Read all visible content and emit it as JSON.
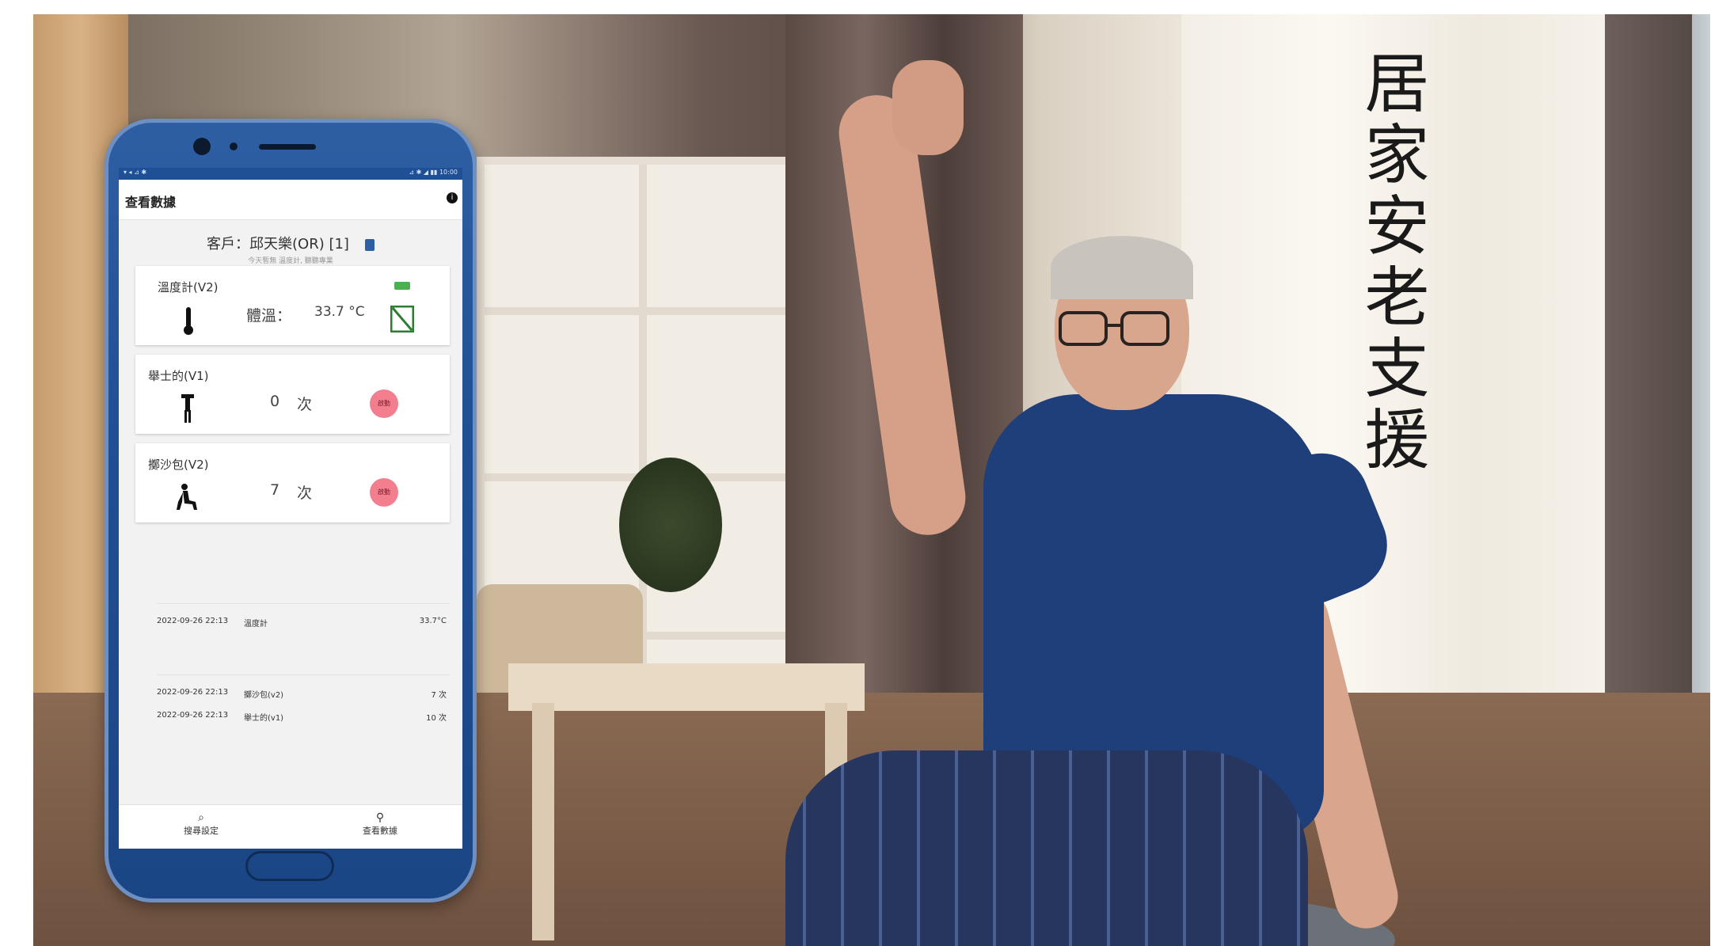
{
  "overlay_title": "居家安老支援",
  "phone": {
    "statusbar_left": "▾ ◂ ⊿ ✱",
    "statusbar_right": "⊿ ✱ ◢ ▮▮ 10:00",
    "app_title": "查看數據",
    "info_icon": "info-icon",
    "client_label": "客戶：邱天樂(OR) [1]",
    "client_sub": "今天暫無 溫度計, 聽聽專業",
    "cards": [
      {
        "name": "溫度計(V2)",
        "label": "體溫：",
        "value": "33.7 °C",
        "icon": "thermometer-icon"
      },
      {
        "name": "舉士的(V1)",
        "value": "0",
        "unit": "次",
        "icon": "standing-person-icon",
        "badge": "啟動"
      },
      {
        "name": "擲沙包(V2)",
        "value": "7",
        "unit": "次",
        "icon": "seated-person-icon",
        "badge": "啟動"
      }
    ],
    "records": [
      {
        "date": "2022-09-26 22:13",
        "name": "溫度計",
        "value": "33.7°C"
      },
      {
        "date": "2022-09-26 22:13",
        "name": "擲沙包(v2)",
        "value": "7 次"
      },
      {
        "date": "2022-09-26 22:13",
        "name": "舉士的(v1)",
        "value": "10 次"
      }
    ],
    "nav": [
      {
        "label": "搜尋設定",
        "icon": "search-icon"
      },
      {
        "label": "查看數據",
        "icon": "link-icon"
      }
    ]
  }
}
